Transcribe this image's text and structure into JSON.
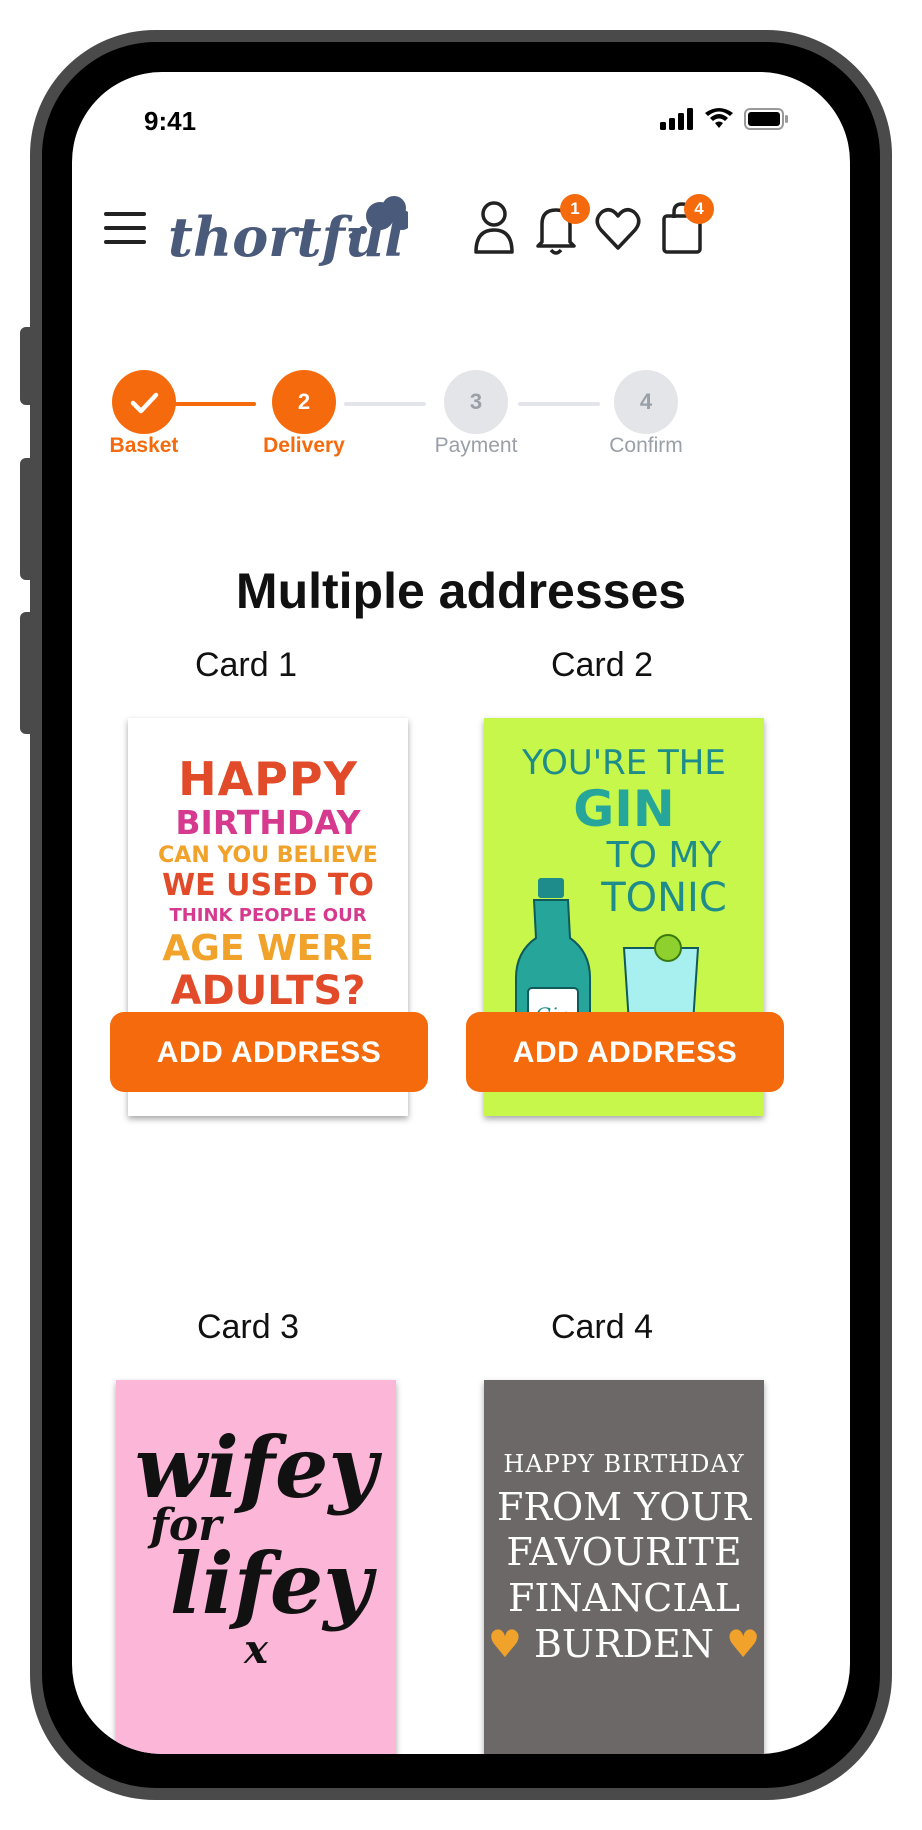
{
  "status_bar": {
    "time": "9:41"
  },
  "header": {
    "logo_text": "thortful",
    "notifications_badge": "1",
    "basket_badge": "4"
  },
  "steps": [
    {
      "number": "",
      "label": "Basket",
      "state": "done"
    },
    {
      "number": "2",
      "label": "Delivery",
      "state": "active"
    },
    {
      "number": "3",
      "label": "Payment",
      "state": "pending"
    },
    {
      "number": "4",
      "label": "Confirm",
      "state": "pending"
    }
  ],
  "page_title": "Multiple addresses",
  "cards": [
    {
      "label": "Card 1",
      "button": "ADD ADDRESS",
      "art_lines": [
        "HAPPY",
        "BIRTHDAY",
        "CAN YOU BELIEVE",
        "WE USED TO",
        "THINK PEOPLE OUR",
        "AGE WERE",
        "ADULTS?"
      ]
    },
    {
      "label": "Card 2",
      "button": "ADD ADDRESS",
      "art_lines": [
        "YOU'RE THE",
        "GIN",
        "TO MY",
        "TONIC",
        "Gin"
      ]
    },
    {
      "label": "Card 3",
      "art_lines": [
        "wifey",
        "for",
        "lifey",
        "x"
      ]
    },
    {
      "label": "Card 4",
      "art_lines": [
        "HAPPY BIRTHDAY",
        "FROM YOUR",
        "FAVOURITE",
        "FINANCIAL",
        "BURDEN"
      ]
    }
  ],
  "colors": {
    "accent": "#f46a0c",
    "pending_circle": "#e4e5e8",
    "pending_text": "#9aa0a8",
    "logo": "#4a5a7a"
  }
}
